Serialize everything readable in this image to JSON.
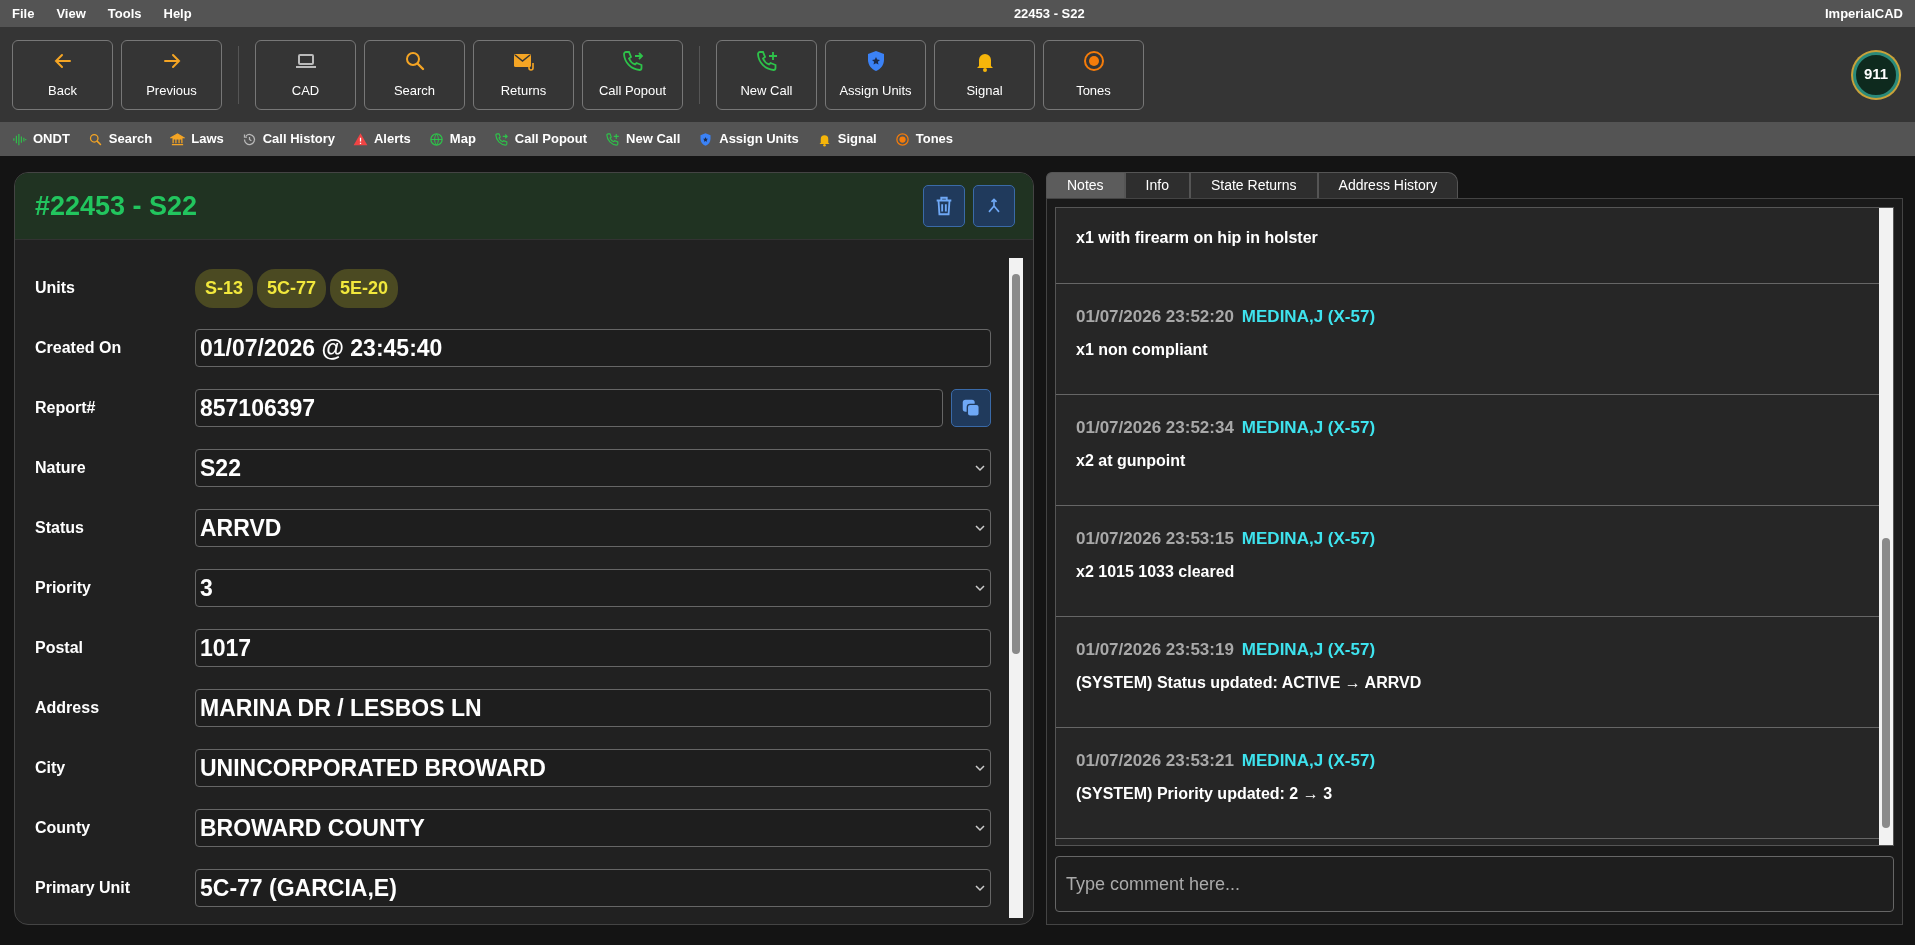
{
  "menu": {
    "items": [
      "File",
      "View",
      "Tools",
      "Help"
    ],
    "title": "22453 - S22",
    "brand": "ImperialCAD"
  },
  "toolbar": {
    "groups": [
      [
        {
          "kind": "arrow-left",
          "label": "Back"
        },
        {
          "kind": "arrow-right",
          "label": "Previous"
        }
      ],
      [
        {
          "kind": "laptop",
          "label": "CAD"
        },
        {
          "kind": "search",
          "label": "Search"
        },
        {
          "kind": "mail",
          "label": "Returns"
        },
        {
          "kind": "phone-out",
          "label": "Call Popout"
        }
      ],
      [
        {
          "kind": "phone-plus",
          "label": "New Call"
        },
        {
          "kind": "shield",
          "label": "Assign Units"
        },
        {
          "kind": "bell",
          "label": "Signal"
        },
        {
          "kind": "target",
          "label": "Tones"
        }
      ]
    ],
    "logo_text": "911"
  },
  "quickbar": [
    {
      "kind": "wave",
      "label": "ONDT"
    },
    {
      "kind": "search",
      "label": "Search"
    },
    {
      "kind": "bank",
      "label": "Laws"
    },
    {
      "kind": "history",
      "label": "Call History"
    },
    {
      "kind": "warning",
      "label": "Alerts"
    },
    {
      "kind": "globe",
      "label": "Map"
    },
    {
      "kind": "phone-out",
      "label": "Call Popout"
    },
    {
      "kind": "phone-plus",
      "label": "New Call"
    },
    {
      "kind": "shield",
      "label": "Assign Units"
    },
    {
      "kind": "bell",
      "label": "Signal"
    },
    {
      "kind": "target",
      "label": "Tones"
    }
  ],
  "call": {
    "title": "#22453 - S22",
    "fields": [
      {
        "kind": "units",
        "label": "Units",
        "units": [
          "S-13",
          "5C-77",
          "5E-20"
        ]
      },
      {
        "kind": "text",
        "label": "Created On",
        "value": "01/07/2026 @ 23:45:40"
      },
      {
        "kind": "copy",
        "label": "Report#",
        "value": "857106397"
      },
      {
        "kind": "select",
        "label": "Nature",
        "value": "S22"
      },
      {
        "kind": "select",
        "label": "Status",
        "value": "ARRVD"
      },
      {
        "kind": "select",
        "label": "Priority",
        "value": "3"
      },
      {
        "kind": "text",
        "label": "Postal",
        "value": "1017"
      },
      {
        "kind": "text",
        "label": "Address",
        "value": "MARINA DR / LESBOS LN"
      },
      {
        "kind": "select",
        "label": "City",
        "value": "UNINCORPORATED BROWARD"
      },
      {
        "kind": "select",
        "label": "County",
        "value": "BROWARD COUNTY"
      },
      {
        "kind": "select",
        "label": "Primary Unit",
        "value": "5C-77 (GARCIA,E)"
      }
    ]
  },
  "tabs": [
    {
      "label": "Notes",
      "selected": true
    },
    {
      "label": "Info",
      "selected": false
    },
    {
      "label": "State Returns",
      "selected": false
    },
    {
      "label": "Address History",
      "selected": false
    }
  ],
  "notes": [
    {
      "text": "x1 with firearm on hip in holster"
    },
    {
      "time": "01/07/2026 23:52:20",
      "author": "MEDINA,J (X-57)",
      "text": "x1 non compliant"
    },
    {
      "time": "01/07/2026 23:52:34",
      "author": "MEDINA,J (X-57)",
      "text": "x2 at gunpoint"
    },
    {
      "time": "01/07/2026 23:53:15",
      "author": "MEDINA,J (X-57)",
      "text": "x2 1015 1033 cleared"
    },
    {
      "time": "01/07/2026 23:53:19",
      "author": "MEDINA,J (X-57)",
      "text": "(SYSTEM) Status updated: ACTIVE → ARRVD"
    },
    {
      "time": "01/07/2026 23:53:21",
      "author": "MEDINA,J (X-57)",
      "text": "(SYSTEM) Priority updated: 2 → 3"
    }
  ],
  "comment": {
    "placeholder": "Type comment here..."
  }
}
